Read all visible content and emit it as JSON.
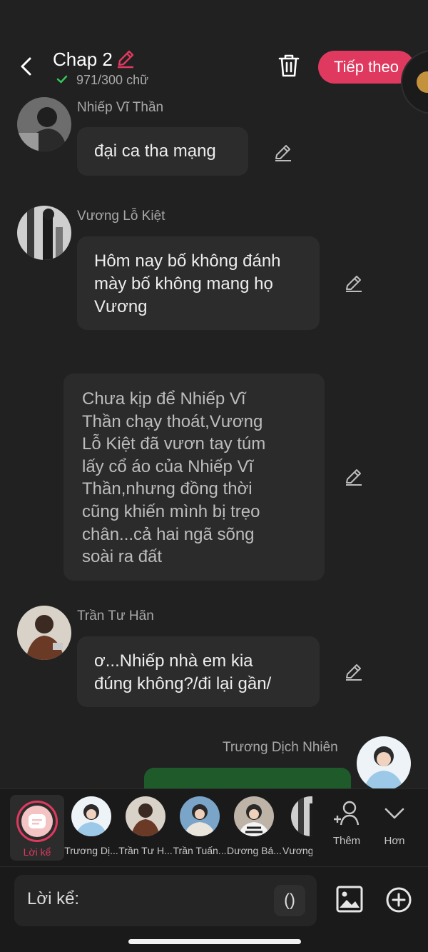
{
  "header": {
    "title": "Chap 2",
    "word_count": "971/300 chữ",
    "next_label": "Tiếp theo"
  },
  "messages": [
    {
      "speaker": "Nhiếp Vĩ Thần",
      "lines": [
        "đại ca tha mạng"
      ]
    },
    {
      "speaker": "Vương Lỗ Kiệt",
      "lines": [
        "Hôm nay bố không đánh",
        "mày bố không mang họ",
        "Vương"
      ]
    },
    {
      "narration": [
        "Chưa kịp để Nhiếp Vĩ",
        "Thần chạy thoát,Vương",
        "Lỗ Kiệt đã vươn tay túm",
        "lấy cổ áo của Nhiếp Vĩ",
        "Thần,nhưng đồng thời",
        "cũng khiến mình bị trẹo",
        "chân...cả hai ngã sõng",
        "soài ra đất"
      ]
    },
    {
      "speaker": "Trần Tư Hãn",
      "lines": [
        "ơ...Nhiếp nhà em kia",
        "đúng không?/đi lại gần/"
      ]
    },
    {
      "speaker": "Trương Dịch Nhiên"
    }
  ],
  "bottom": {
    "narrator_label": "Lời kể",
    "characters": [
      "Trương Dị...",
      "Trần Tư H...",
      "Trần Tuấn...",
      "Dương Bá...",
      "Vương"
    ],
    "more_label": "Thêm",
    "expand_label": "Hơn",
    "input_label": "Lời kể:",
    "paren_label": "()"
  }
}
